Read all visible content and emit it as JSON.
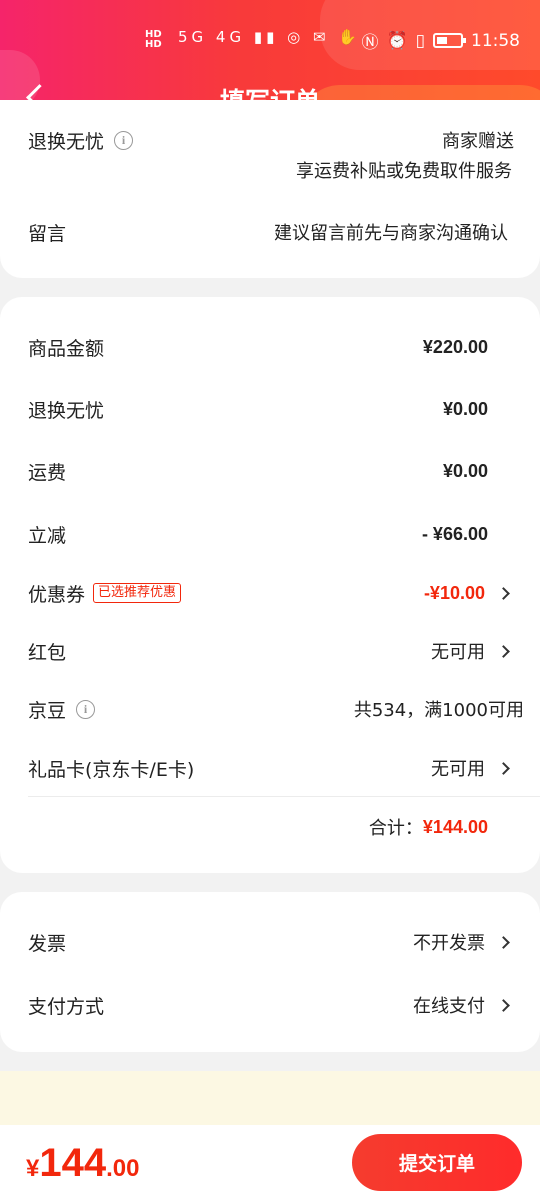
{
  "status_bar": {
    "signal_text": "HD HD",
    "network_icons": "5G 4G",
    "time": "11:58"
  },
  "nav": {
    "title": "填写订单"
  },
  "top_card": {
    "return_label": "退换无忧",
    "return_value": "商家赠送",
    "return_sub": "享运费补贴或免费取件服务",
    "message_label": "留言",
    "message_placeholder": "建议留言前先与商家沟通确认"
  },
  "summary": {
    "goods_label": "商品金额",
    "goods_value": "¥220.00",
    "return_label": "退换无忧",
    "return_value": "¥0.00",
    "shipping_label": "运费",
    "shipping_value": "¥0.00",
    "discount_label": "立减",
    "discount_value": "- ¥66.00",
    "coupon_label": "优惠券",
    "coupon_tag": "已选推荐优惠",
    "coupon_value": "-¥10.00",
    "redpacket_label": "红包",
    "redpacket_value": "无可用",
    "jingdou_label": "京豆",
    "jingdou_value": "共534，满1000可用",
    "giftcard_label": "礼品卡",
    "giftcard_sub": "(京东卡/E卡)",
    "giftcard_value": "无可用",
    "total_label": "合计：",
    "total_value": "¥144.00"
  },
  "extra": {
    "invoice_label": "发票",
    "invoice_value": "不开发票",
    "payment_label": "支付方式",
    "payment_value": "在线支付"
  },
  "bottom": {
    "currency": "¥",
    "total_int": "144",
    "total_dec": ".00",
    "submit_label": "提交订单"
  },
  "colors": {
    "accent_red": "#f2270c",
    "header_gradient_start": "#f5246a",
    "header_gradient_end": "#ff4a2b"
  }
}
